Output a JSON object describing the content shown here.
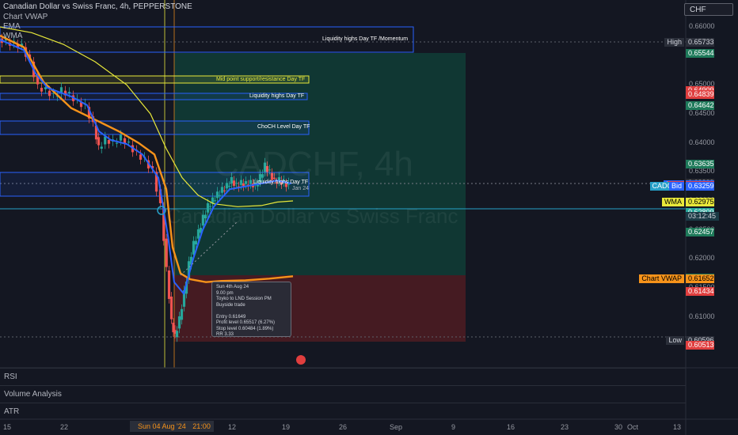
{
  "header": {
    "symbol_line": "Canadian Dollar vs Swiss Franc, 4h, PEPPERSTONE",
    "indicators": [
      "Chart VWAP",
      "EMA",
      "WMA"
    ]
  },
  "currency_selector": "CHF",
  "watermark": {
    "ticker": "CADCHF, 4h",
    "name": "Canadian Dollar vs Swiss Franc"
  },
  "zones": [
    {
      "label": "Liquidity highs Day TF /Momentum",
      "color": "#2962ff"
    },
    {
      "label": "Mid point support/resistance Day TF",
      "color": "#e8e83a"
    },
    {
      "label": "Liquidity highs Day TF",
      "color": "#2962ff"
    },
    {
      "label": "ChoCH Level Day TF",
      "color": "#2962ff"
    },
    {
      "label": "Liquidity highs Day TF",
      "color": "#2962ff"
    }
  ],
  "zone_side_label": "Jan 24",
  "trade_note": {
    "lines": [
      "Sun 4th Aug 24",
      "9.00 pm",
      "Toyko to LND Session PM",
      "Buyside trade",
      "",
      "Entry 0.61649",
      "Profit level 0.65517 (6.27%)",
      "Stop level 0.60484 (1.89%)",
      "RR 3.33"
    ]
  },
  "price_scale": [
    "0.66000",
    "0.65500",
    "0.65000",
    "0.64500",
    "0.64000",
    "0.63500",
    "0.63000",
    "0.62500",
    "0.62000",
    "0.61500",
    "0.61000",
    "0.60500"
  ],
  "price_tags": [
    {
      "name": "High",
      "label": "High",
      "value": "0.65733",
      "price": 0.65733,
      "color": "#2a2e39",
      "fg": "#d1d4dc"
    },
    {
      "name": "target",
      "label": "",
      "value": "0.65544",
      "price": 0.65544,
      "color": "#1e7a5a",
      "fg": "#ffffff"
    },
    {
      "name": "red1",
      "label": "",
      "value": "0.64909",
      "price": 0.64909,
      "color": "#e03e3e",
      "fg": "#ffffff"
    },
    {
      "name": "red2",
      "label": "",
      "value": "0.64839",
      "price": 0.64839,
      "color": "#e03e3e",
      "fg": "#ffffff"
    },
    {
      "name": "green1",
      "label": "",
      "value": "0.64642",
      "price": 0.64642,
      "color": "#1e7a5a",
      "fg": "#ffffff"
    },
    {
      "name": "green2",
      "label": "",
      "value": "0.63635",
      "price": 0.63635,
      "color": "#1e7a5a",
      "fg": "#ffffff"
    },
    {
      "name": "dark1",
      "label": "",
      "value": "0.63309",
      "price": 0.63309,
      "color": "#2a2e39",
      "fg": "#d1d4dc"
    },
    {
      "name": "ema",
      "label": "EMA",
      "value": "0.63281",
      "price": 0.63281,
      "color": "#2962ff",
      "fg": "#ffffff"
    },
    {
      "name": "ask",
      "label": "Ask",
      "value": "0.63265",
      "price": 0.63265,
      "color": "#e03e3e",
      "fg": "#ffffff"
    },
    {
      "name": "cadchf",
      "label": "CADCHF",
      "value": "0.63259",
      "price": 0.63259,
      "color": "#26a0c8",
      "fg": "#ffffff"
    },
    {
      "name": "bid",
      "label": "Bid",
      "value": "0.63259",
      "price": 0.63259,
      "color": "#2962ff",
      "fg": "#ffffff"
    },
    {
      "name": "wma",
      "label": "WMA",
      "value": "0.62975",
      "price": 0.62975,
      "color": "#e8e83a",
      "fg": "#000000"
    },
    {
      "name": "teal",
      "label": "",
      "value": "0.62809",
      "price": 0.62809,
      "color": "#26a69a",
      "fg": "#ffffff"
    },
    {
      "name": "green3",
      "label": "",
      "value": "0.62457",
      "price": 0.62457,
      "color": "#1e7a5a",
      "fg": "#ffffff"
    },
    {
      "name": "entry",
      "label": "",
      "value": "0.61676",
      "price": 0.61676,
      "color": "#1e7a5a",
      "fg": "#ffffff"
    },
    {
      "name": "vwap",
      "label": "Chart VWAP",
      "value": "0.61652",
      "price": 0.61652,
      "color": "#f7931a",
      "fg": "#000000"
    },
    {
      "name": "red3",
      "label": "",
      "value": "0.61434",
      "price": 0.61434,
      "color": "#e03e3e",
      "fg": "#ffffff"
    },
    {
      "name": "low",
      "label": "Low",
      "value": "0.60596",
      "price": 0.60596,
      "color": "#2a2e39",
      "fg": "#d1d4dc"
    },
    {
      "name": "stop",
      "label": "",
      "value": "0.60513",
      "price": 0.60513,
      "color": "#e03e3e",
      "fg": "#ffffff"
    }
  ],
  "countdown": "03:12:45",
  "panes": [
    "RSI",
    "Volume Analysis",
    "ATR"
  ],
  "x_axis": [
    "15",
    "22",
    "12",
    "19",
    "26",
    "Sep",
    "9",
    "16",
    "23",
    "30",
    "Oct",
    "13"
  ],
  "selected_date": "Sun 04 Aug '24",
  "selected_time": "21:00",
  "colors": {
    "up": "#26a69a",
    "down": "#ef5350",
    "ema": "#2962ff",
    "wma": "#e8e83a",
    "vwap": "#f7931a",
    "zone_blue": "#2962ff",
    "profit": "#0f3b35",
    "loss": "#4a1c22"
  },
  "chart_data": {
    "type": "candlestick",
    "series": [
      {
        "name": "Chart VWAP"
      },
      {
        "name": "EMA"
      },
      {
        "name": "WMA"
      }
    ],
    "y_range": [
      0.6028,
      0.6624
    ],
    "last_price": 0.63259,
    "high": 0.65733,
    "low": 0.60596,
    "entry": 0.61649,
    "profit_level": 0.65517,
    "stop_level": 0.60484
  }
}
